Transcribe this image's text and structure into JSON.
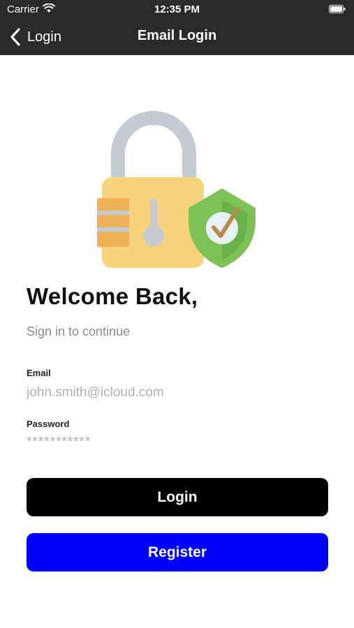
{
  "status_bar": {
    "carrier": "Carrier",
    "time": "12:35 PM"
  },
  "nav": {
    "back_label": "Login",
    "title": "Email Login"
  },
  "content": {
    "welcome": "Welcome Back,",
    "subtitle": "Sign in to continue"
  },
  "form": {
    "email_label": "Email",
    "email_placeholder": "john.smith@icloud.com",
    "password_label": "Password",
    "password_placeholder": "***********"
  },
  "buttons": {
    "login_label": "Login",
    "register_label": "Register"
  },
  "colors": {
    "nav_background": "#2a2a2a",
    "login_button": "#000000",
    "register_button": "#0000ff",
    "lock_body": "#f7d47c",
    "lock_shackle": "#c5cbd3",
    "shield": "#7cc254"
  }
}
